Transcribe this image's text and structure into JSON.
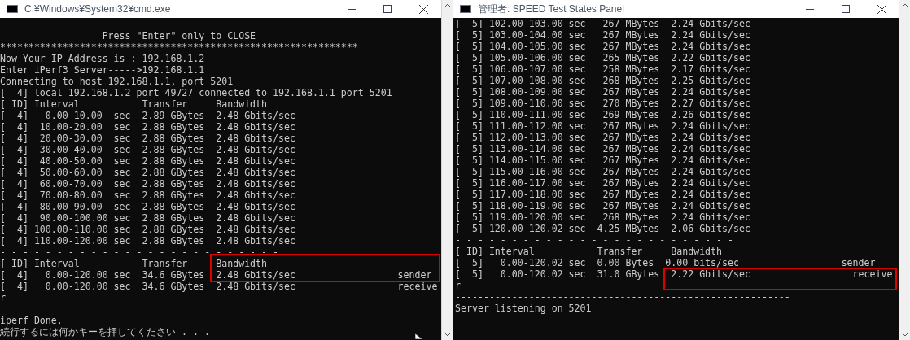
{
  "windows": [
    {
      "title": "C:¥Windows¥System32¥cmd.exe",
      "lines": [
        {
          "text": "                  Press \"Enter\" only to CLOSE"
        },
        {
          "text": "***************************************************************"
        },
        {
          "text": "Now Your IP Address is : 192.168.1.2"
        },
        {
          "text": "Enter iPerf3 Server----->192.168.1.1"
        },
        {
          "text": "Connecting to host 192.168.1.1, port 5201"
        },
        {
          "text": "[  4] local 192.168.1.2 port 49727 connected to 192.168.1.1 port 5201"
        },
        {
          "text": "[ ID] Interval           Transfer     Bandwidth"
        },
        {
          "text": "[  4]   0.00-10.00  sec  2.89 GBytes  2.48 Gbits/sec"
        },
        {
          "text": "[  4]  10.00-20.00  sec  2.88 GBytes  2.48 Gbits/sec"
        },
        {
          "text": "[  4]  20.00-30.00  sec  2.88 GBytes  2.48 Gbits/sec"
        },
        {
          "text": "[  4]  30.00-40.00  sec  2.88 GBytes  2.48 Gbits/sec"
        },
        {
          "text": "[  4]  40.00-50.00  sec  2.88 GBytes  2.48 Gbits/sec"
        },
        {
          "text": "[  4]  50.00-60.00  sec  2.88 GBytes  2.48 Gbits/sec"
        },
        {
          "text": "[  4]  60.00-70.00  sec  2.88 GBytes  2.48 Gbits/sec"
        },
        {
          "text": "[  4]  70.00-80.00  sec  2.88 GBytes  2.48 Gbits/sec"
        },
        {
          "text": "[  4]  80.00-90.00  sec  2.88 GBytes  2.48 Gbits/sec"
        },
        {
          "text": "[  4]  90.00-100.00 sec  2.88 GBytes  2.48 Gbits/sec"
        },
        {
          "text": "[  4] 100.00-110.00 sec  2.88 GBytes  2.48 Gbits/sec"
        },
        {
          "text": "[  4] 110.00-120.00 sec  2.88 GBytes  2.48 Gbits/sec"
        },
        {
          "text": "- - - - - - - - - - - - - - - - - - - - - - - - -"
        },
        {
          "text": "[ ID] Interval           Transfer     Bandwidth"
        },
        {
          "text": "[  4]   0.00-120.00 sec  34.6 GBytes  2.48 Gbits/sec                  sender"
        },
        {
          "text": "[  4]   0.00-120.00 sec  34.6 GBytes  2.48 Gbits/sec                  receive"
        },
        {
          "text": "r"
        },
        {
          "text": "iperf Done."
        },
        {
          "text": "続行するには何かキーを押してください . . ."
        }
      ]
    },
    {
      "title": "管理者: SPEED Test States Panel",
      "lines": [
        {
          "text": "[  5] 102.00-103.00 sec   267 MBytes  2.24 Gbits/sec"
        },
        {
          "text": "[  5] 103.00-104.00 sec   267 MBytes  2.24 Gbits/sec"
        },
        {
          "text": "[  5] 104.00-105.00 sec   267 MBytes  2.24 Gbits/sec"
        },
        {
          "text": "[  5] 105.00-106.00 sec   265 MBytes  2.22 Gbits/sec"
        },
        {
          "text": "[  5] 106.00-107.00 sec   258 MBytes  2.17 Gbits/sec"
        },
        {
          "text": "[  5] 107.00-108.00 sec   268 MBytes  2.25 Gbits/sec"
        },
        {
          "text": "[  5] 108.00-109.00 sec   267 MBytes  2.24 Gbits/sec"
        },
        {
          "text": "[  5] 109.00-110.00 sec   270 MBytes  2.27 Gbits/sec"
        },
        {
          "text": "[  5] 110.00-111.00 sec   269 MBytes  2.26 Gbits/sec"
        },
        {
          "text": "[  5] 111.00-112.00 sec   267 MBytes  2.24 Gbits/sec"
        },
        {
          "text": "[  5] 112.00-113.00 sec   267 MBytes  2.24 Gbits/sec"
        },
        {
          "text": "[  5] 113.00-114.00 sec   267 MBytes  2.24 Gbits/sec"
        },
        {
          "text": "[  5] 114.00-115.00 sec   267 MBytes  2.24 Gbits/sec"
        },
        {
          "text": "[  5] 115.00-116.00 sec   267 MBytes  2.24 Gbits/sec"
        },
        {
          "text": "[  5] 116.00-117.00 sec   267 MBytes  2.24 Gbits/sec"
        },
        {
          "text": "[  5] 117.00-118.00 sec   267 MBytes  2.24 Gbits/sec"
        },
        {
          "text": "[  5] 118.00-119.00 sec   267 MBytes  2.24 Gbits/sec"
        },
        {
          "text": "[  5] 119.00-120.00 sec   268 MBytes  2.24 Gbits/sec"
        },
        {
          "text": "[  5] 120.00-120.02 sec  4.25 MBytes  2.06 Gbits/sec"
        },
        {
          "text": "- - - - - - - - - - - - - - - - - - - - - - - - -"
        },
        {
          "text": "[ ID] Interval           Transfer     Bandwidth"
        },
        {
          "text": "[  5]   0.00-120.02 sec  0.00 Bytes  0.00 bits/sec                  sender"
        },
        {
          "text": "[  5]   0.00-120.02 sec  31.0 GBytes  2.22 Gbits/sec                  receive"
        },
        {
          "text": "r"
        },
        {
          "text": "-----------------------------------------------------------"
        },
        {
          "text": "Server listening on 5201"
        },
        {
          "text": "-----------------------------------------------------------"
        }
      ]
    }
  ]
}
